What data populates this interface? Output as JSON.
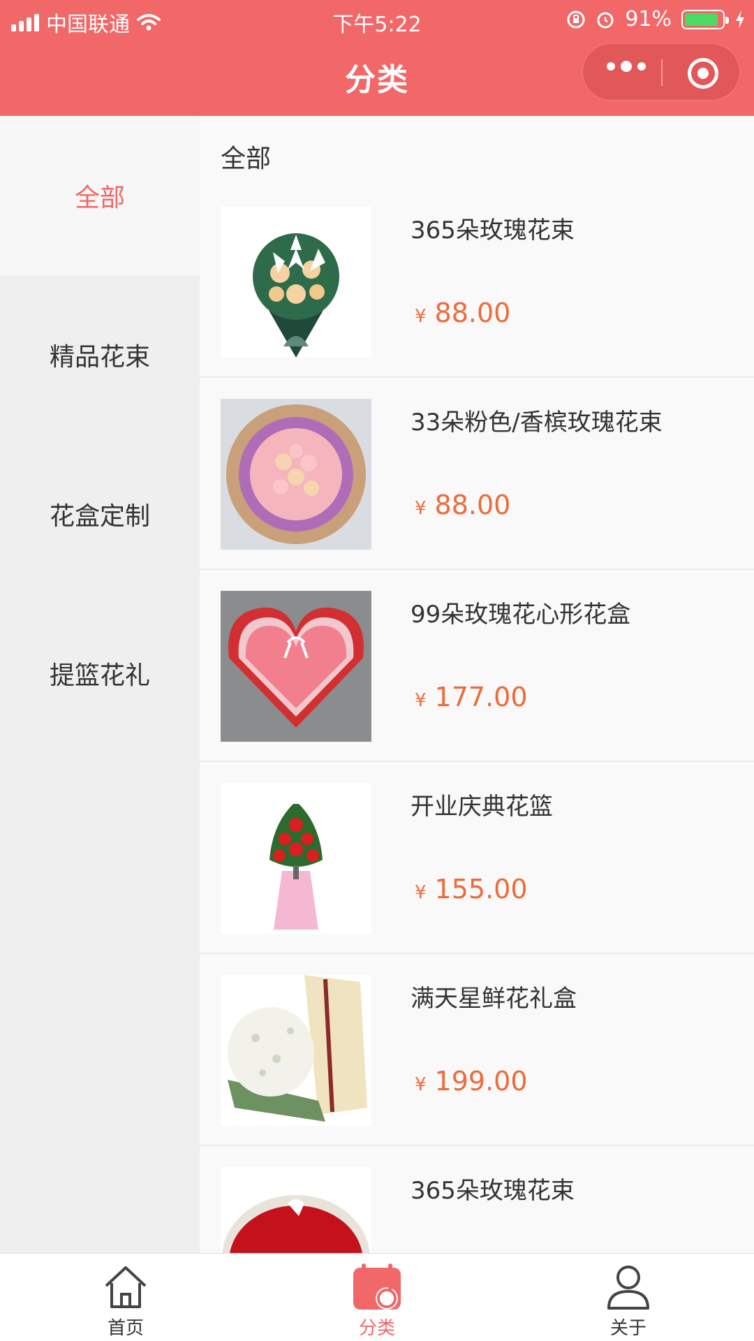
{
  "status_bar": {
    "carrier": "中国联通",
    "time": "下午5:22",
    "battery": "91%",
    "battery_level": 0.91
  },
  "nav": {
    "title": "分类"
  },
  "sidebar": {
    "items": [
      {
        "label": "全部",
        "active": true
      },
      {
        "label": "精品花束",
        "active": false
      },
      {
        "label": "花盒定制",
        "active": false
      },
      {
        "label": "提篮花礼",
        "active": false
      }
    ]
  },
  "content": {
    "section_title": "全部",
    "currency": "¥",
    "products": [
      {
        "name": "365朵玫瑰花束",
        "price": "88.00",
        "image": "bouquet-lily-rose"
      },
      {
        "name": "33朵粉色/香槟玫瑰花束",
        "price": "88.00",
        "image": "bouquet-pink-rose"
      },
      {
        "name": "99朵玫瑰花心形花盒",
        "price": "177.00",
        "image": "heart-box-rose"
      },
      {
        "name": "开业庆典花篮",
        "price": "155.00",
        "image": "celebration-basket"
      },
      {
        "name": "满天星鲜花礼盒",
        "price": "199.00",
        "image": "baby-breath-box"
      },
      {
        "name": "365朵玫瑰花束",
        "price": "",
        "image": "red-rose-heart"
      }
    ]
  },
  "tabbar": {
    "tabs": [
      {
        "label": "首页",
        "icon": "home-icon",
        "active": false
      },
      {
        "label": "分类",
        "icon": "category-icon",
        "active": true
      },
      {
        "label": "关于",
        "icon": "user-icon",
        "active": false
      }
    ]
  },
  "colors": {
    "brand": "#f26767",
    "price": "#ee6a3b",
    "sidebar_bg": "#efefef"
  }
}
